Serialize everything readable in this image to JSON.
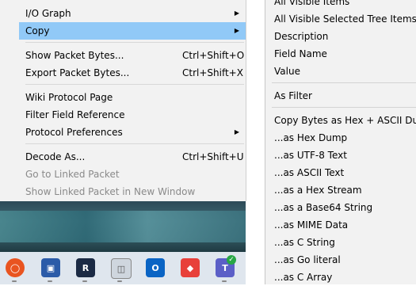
{
  "main_menu": {
    "items": [
      {
        "label": "I/O Graph",
        "shortcut": "",
        "submenu": true,
        "disabled": false,
        "highlighted": false
      },
      {
        "label": "Copy",
        "shortcut": "",
        "submenu": true,
        "disabled": false,
        "highlighted": true
      },
      {
        "label": "Show Packet Bytes...",
        "shortcut": "Ctrl+Shift+O",
        "submenu": false,
        "disabled": false,
        "highlighted": false
      },
      {
        "label": "Export Packet Bytes...",
        "shortcut": "Ctrl+Shift+X",
        "submenu": false,
        "disabled": false,
        "highlighted": false
      },
      {
        "label": "Wiki Protocol Page",
        "shortcut": "",
        "submenu": false,
        "disabled": false,
        "highlighted": false
      },
      {
        "label": "Filter Field Reference",
        "shortcut": "",
        "submenu": false,
        "disabled": false,
        "highlighted": false
      },
      {
        "label": "Protocol Preferences",
        "shortcut": "",
        "submenu": true,
        "disabled": false,
        "highlighted": false
      },
      {
        "label": "Decode As...",
        "shortcut": "Ctrl+Shift+U",
        "submenu": false,
        "disabled": false,
        "highlighted": false
      },
      {
        "label": "Go to Linked Packet",
        "shortcut": "",
        "submenu": false,
        "disabled": true,
        "highlighted": false
      },
      {
        "label": "Show Linked Packet in New Window",
        "shortcut": "",
        "submenu": false,
        "disabled": true,
        "highlighted": false
      }
    ]
  },
  "copy_submenu": {
    "items": [
      "All Visible Items",
      "All Visible Selected Tree Items",
      "Description",
      "Field Name",
      "Value",
      "As Filter",
      "Copy Bytes as Hex + ASCII Dump",
      "...as Hex Dump",
      "...as UTF-8 Text",
      "...as ASCII Text",
      "...as a Hex Stream",
      "...as a Base64 String",
      "...as MIME Data",
      "...as C String",
      "...as Go literal",
      "...as C Array"
    ]
  },
  "taskbar": {
    "icons": [
      "ubuntu-icon",
      "remote-desktop-icon",
      "rstudio-icon",
      "chrome-window-icon",
      "outlook-icon",
      "anydesk-icon",
      "teams-icon"
    ],
    "colors": {
      "highlight": "#91c9f7",
      "menu_bg": "#f2f2f2",
      "disabled_text": "#8a8a8a"
    }
  }
}
